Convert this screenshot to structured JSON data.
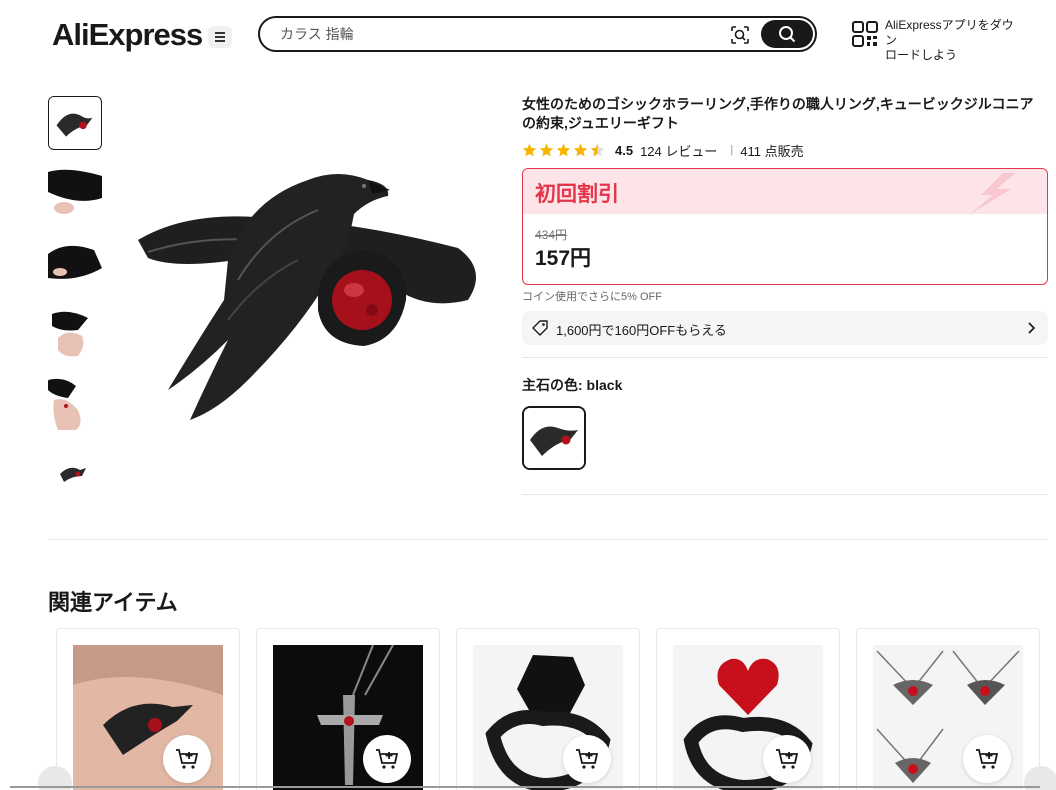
{
  "header": {
    "logo": "AliExpress",
    "search_placeholder": "カラス 指輪",
    "app_download_line1": "AliExpressアプリをダウン",
    "app_download_line2": "ロードしよう"
  },
  "product": {
    "title": "女性のためのゴシックホラーリング,手作りの職人リング,キュービックジルコニアの約束,ジュエリーギフト",
    "rating": "4.5",
    "reviews": "124 レビュー",
    "sold": "411 点販売",
    "stars": 4.5,
    "price_banner": "初回割引",
    "original_price": "434円",
    "sale_price": "157円",
    "coin_note": "コイン使用でさらに5% OFF",
    "coupon_text": "1,600円で160円OFFもらえる",
    "color_label": "主石の色: black"
  },
  "gallery": {
    "thumb_count": 6,
    "active_index": 0
  },
  "related": {
    "title": "関連アイテム",
    "items": [
      {
        "name": "raven-ring-on-hand"
      },
      {
        "name": "gothic-cross-necklace"
      },
      {
        "name": "black-skull-ring"
      },
      {
        "name": "red-heart-skull-ring"
      },
      {
        "name": "heart-wing-necklaces"
      }
    ]
  },
  "colors": {
    "accent": "#e5354a",
    "banner_bg": "#fde4e8",
    "star": "#f7b500",
    "text": "#191919"
  }
}
